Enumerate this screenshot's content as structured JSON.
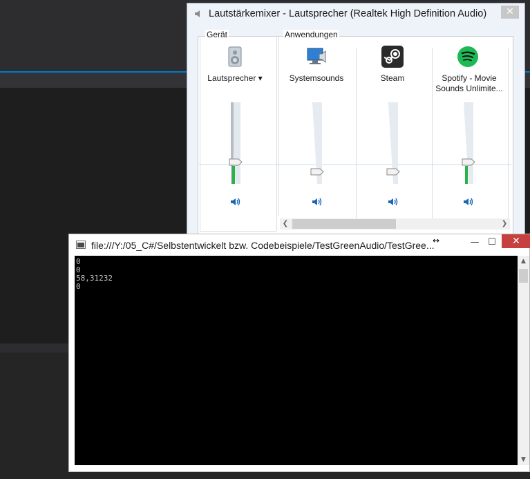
{
  "mixer": {
    "title": "Lautstärkemixer - Lautsprecher (Realtek High Definition Audio)",
    "device_group_label": "Gerät",
    "apps_group_label": "Anwendungen",
    "device": {
      "name": "Lautsprecher",
      "volume_percent": 27,
      "meter_percent": 22
    },
    "apps": [
      {
        "name": "Systemsounds",
        "icon": "system-sounds-icon",
        "volume_percent": 15
      },
      {
        "name": "Steam",
        "icon": "steam-icon",
        "volume_percent": 15
      },
      {
        "name": "Spotify - Movie Sounds Unlimite...",
        "icon": "spotify-icon",
        "volume_percent": 27,
        "meter_percent": 22
      }
    ]
  },
  "console": {
    "title": "file:///Y:/05_C#/Selbstentwickelt bzw. Codebeispiele/TestGreenAudio/TestGree...",
    "output": "0\n0\n58,31232\n0"
  },
  "colors": {
    "accent": "#007acc",
    "meter_green": "#27b24a",
    "console_bg": "#000000",
    "close_red": "#c74040"
  }
}
